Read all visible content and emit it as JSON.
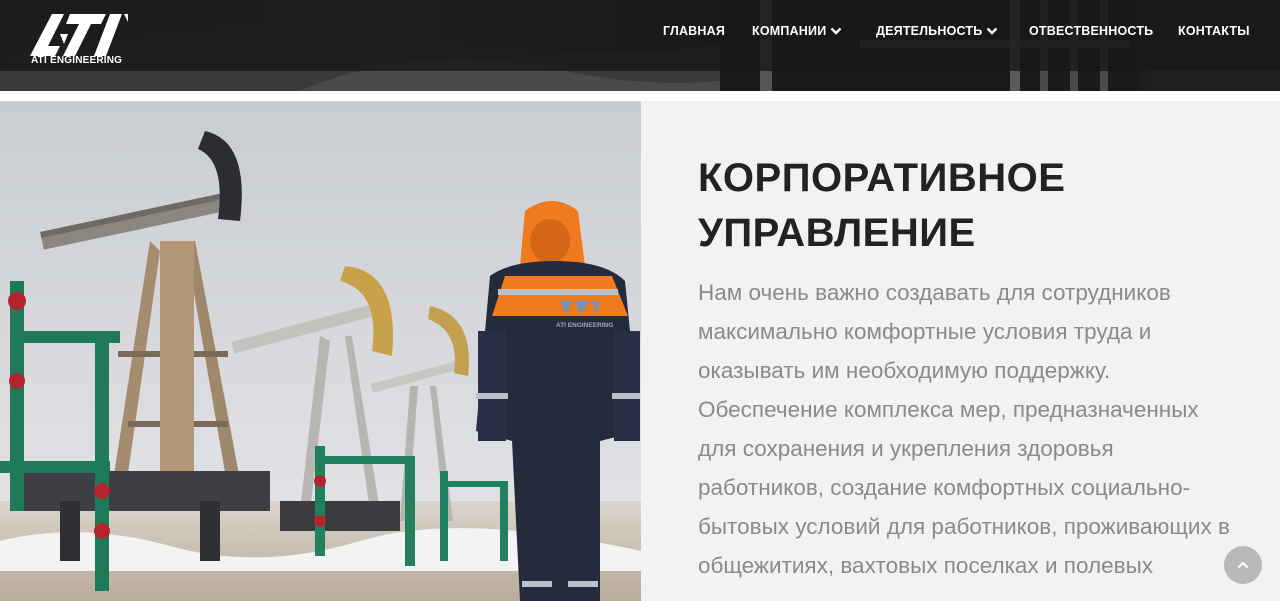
{
  "header": {
    "logo": {
      "mark_text": "ATI",
      "caption": "ATI ENGINEERING"
    },
    "nav": [
      {
        "label": "ГЛАВНАЯ",
        "has_dropdown": false
      },
      {
        "label": "КОМПАНИИ",
        "has_dropdown": true
      },
      {
        "label": "ДЕЯТЕЛЬНОСТЬ",
        "has_dropdown": true
      },
      {
        "label": "ОТВЕСТВЕННОСТЬ",
        "has_dropdown": false
      },
      {
        "label": "КОНТАКТЫ",
        "has_dropdown": false
      }
    ]
  },
  "section": {
    "title_line1": "КОРПОРАТИВНОЕ",
    "title_line2": "УПРАВЛЕНИЕ",
    "paragraph": "Нам очень важно создавать для сотрудников максимально комфортные условия труда и оказывать им необходимую поддержку. Обеспечение комплекса мер, предназначенных для сохранения и укрепления здоровья работников, создание комфортных социально-бытовых условий для работников, проживающих в общежитиях, вахтовых поселках и полевых",
    "photo_jacket_logo": "ATI ENGINEERING"
  },
  "icons": {
    "dropdown": "chevron-down-icon",
    "scroll_top": "chevron-up-icon"
  },
  "colors": {
    "header_bar": "#181818",
    "title": "#222222",
    "body_text": "#8a8a8a",
    "panel_bg": "#f2f2f2",
    "scroll_button": "#b9b9b9",
    "jacket_orange": "#f07a1e",
    "jacket_navy": "#242b3d"
  }
}
